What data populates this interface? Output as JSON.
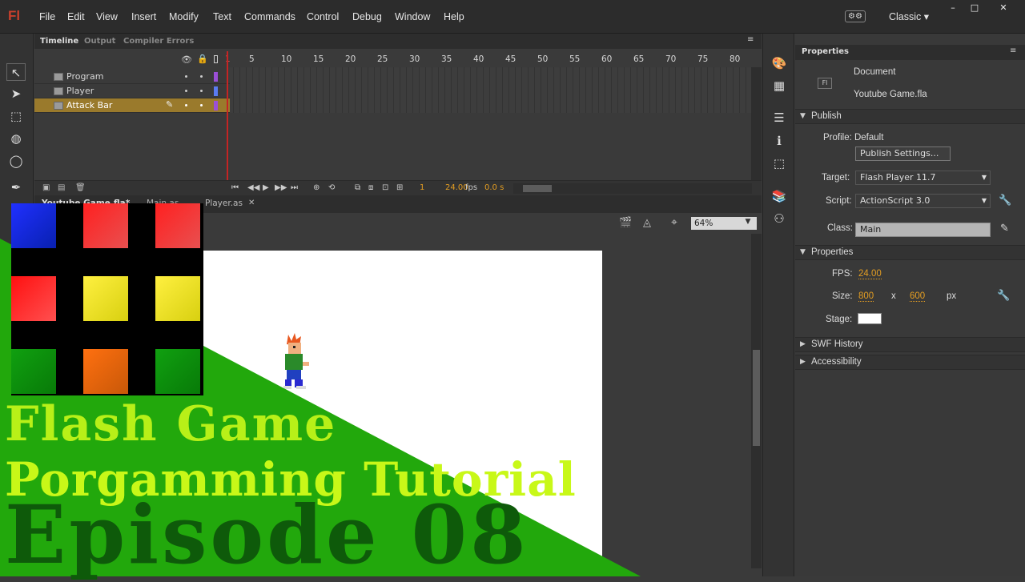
{
  "app": {
    "logo": "Fl"
  },
  "menu": [
    "File",
    "Edit",
    "View",
    "Insert",
    "Modify",
    "Text",
    "Commands",
    "Control",
    "Debug",
    "Window",
    "Help"
  ],
  "workspace": {
    "label": "Classic"
  },
  "window_buttons": [
    "–",
    "□",
    "✕"
  ],
  "timeline": {
    "tabs": [
      "Timeline",
      "Output",
      "Compiler Errors"
    ],
    "ruler": [
      "1",
      "5",
      "10",
      "15",
      "20",
      "25",
      "30",
      "35",
      "40",
      "45",
      "50",
      "55",
      "60",
      "65",
      "70",
      "75",
      "80"
    ],
    "layers": [
      {
        "name": "Program",
        "color": "#9b4fd6"
      },
      {
        "name": "Player",
        "color": "#5a7bf0"
      },
      {
        "name": "Attack Bar",
        "color": "#9b4fd6"
      }
    ],
    "frame": "1",
    "fps": "24.00",
    "fps_unit": "fps",
    "time": "0.0 s"
  },
  "doc_tabs": [
    "Youtube Game.fla*",
    "Main.as",
    "Player.as"
  ],
  "zoom": "64%",
  "properties": {
    "tab": "Properties",
    "doc_badge": "Fl",
    "doc_type": "Document",
    "doc_name": "Youtube Game.fla",
    "publish_section": "Publish",
    "profile": "Profile: Default",
    "publish_settings": "Publish Settings...",
    "target_label": "Target:",
    "target_value": "Flash Player 11.7",
    "script_label": "Script:",
    "script_value": "ActionScript 3.0",
    "class_label": "Class:",
    "class_value": "Main",
    "props_section": "Properties",
    "fps_label": "FPS:",
    "fps_value": "24.00",
    "size_label": "Size:",
    "width": "800",
    "x": "x",
    "height": "600",
    "unit": "px",
    "stage_label": "Stage:",
    "stage_color": "#ffffff",
    "swf_history": "SWF History",
    "accessibility": "Accessibility"
  },
  "overlay": {
    "line1": "Flash Game",
    "line2": "Porgamming Tutorial",
    "line3": "Episode 08",
    "grid_colors": [
      "#1018e0",
      "#e42828",
      "#e42828",
      "#e42828",
      "#e8e020",
      "#e0e020",
      "#18a018",
      "#e06010",
      "#18a018"
    ]
  }
}
